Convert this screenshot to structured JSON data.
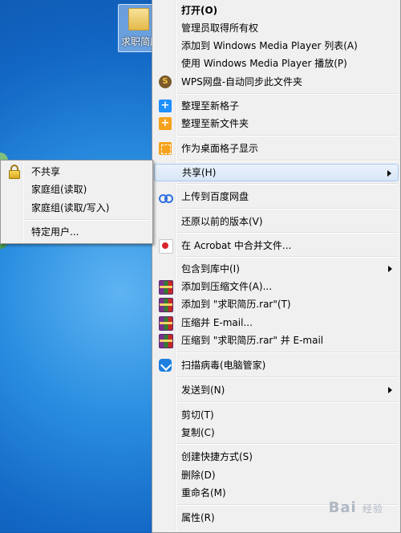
{
  "desktop": {
    "icon_label": "求职简历"
  },
  "context_menu": {
    "items": [
      {
        "label": "打开(O)"
      },
      {
        "label": "管理员取得所有权"
      },
      {
        "label": "添加到 Windows Media Player 列表(A)"
      },
      {
        "label": "使用 Windows Media Player 播放(P)"
      },
      {
        "label": "WPS网盘-自动同步此文件夹",
        "icon": "wps-cloud-icon"
      },
      {
        "label": "整理至新格子",
        "icon": "fences-add-icon"
      },
      {
        "label": "整理至新文件夹",
        "icon": "new-folder-icon"
      },
      {
        "label": "作为桌面格子显示",
        "icon": "desktop-fence-icon"
      },
      {
        "label": "共享(H)"
      },
      {
        "label": "上传到百度网盘",
        "icon": "baidu-netdisk-icon"
      },
      {
        "label": "还原以前的版本(V)"
      },
      {
        "label": "在 Acrobat 中合并文件...",
        "icon": "acrobat-icon"
      },
      {
        "label": "包含到库中(I)"
      },
      {
        "label": "添加到压缩文件(A)...",
        "icon": "winrar-icon"
      },
      {
        "label": "添加到 \"求职简历.rar\"(T)",
        "icon": "winrar-icon"
      },
      {
        "label": "压缩并 E-mail...",
        "icon": "winrar-icon"
      },
      {
        "label": "压缩到 \"求职简历.rar\" 并 E-mail",
        "icon": "winrar-icon"
      },
      {
        "label": "扫描病毒(电脑管家)",
        "icon": "tencent-shield-icon"
      },
      {
        "label": "发送到(N)"
      },
      {
        "label": "剪切(T)"
      },
      {
        "label": "复制(C)"
      },
      {
        "label": "创建快捷方式(S)"
      },
      {
        "label": "删除(D)"
      },
      {
        "label": "重命名(M)"
      },
      {
        "label": "属性(R)"
      }
    ]
  },
  "share_submenu": {
    "items": [
      {
        "label": "不共享",
        "icon": "lock-icon"
      },
      {
        "label": "家庭组(读取)"
      },
      {
        "label": "家庭组(读取/写入)"
      },
      {
        "label": "特定用户..."
      }
    ]
  },
  "watermark": {
    "text": "Bai",
    "suffix": "经验"
  },
  "colors": {
    "menu_bg": "#f0f0f0",
    "highlight": "#d7e6f7",
    "desktop_blue": "#1266c4"
  }
}
